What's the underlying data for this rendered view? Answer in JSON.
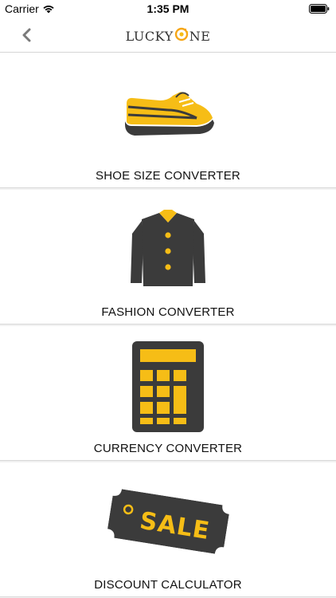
{
  "status_bar": {
    "carrier": "Carrier",
    "time": "1:35 PM"
  },
  "nav": {
    "back_icon": "chevron-left-icon",
    "logo_text_left": "LUCKY",
    "logo_text_right": "NE"
  },
  "colors": {
    "accent": "#f6bd16",
    "dark": "#3b3b3b"
  },
  "items": [
    {
      "label": "SHOE SIZE CONVERTER",
      "icon": "shoe-icon"
    },
    {
      "label": "FASHION CONVERTER",
      "icon": "jacket-icon"
    },
    {
      "label": "CURRENCY CONVERTER",
      "icon": "calculator-icon"
    },
    {
      "label": "DISCOUNT CALCULATOR",
      "icon": "sale-tag-icon",
      "tag_text": "SALE"
    }
  ]
}
